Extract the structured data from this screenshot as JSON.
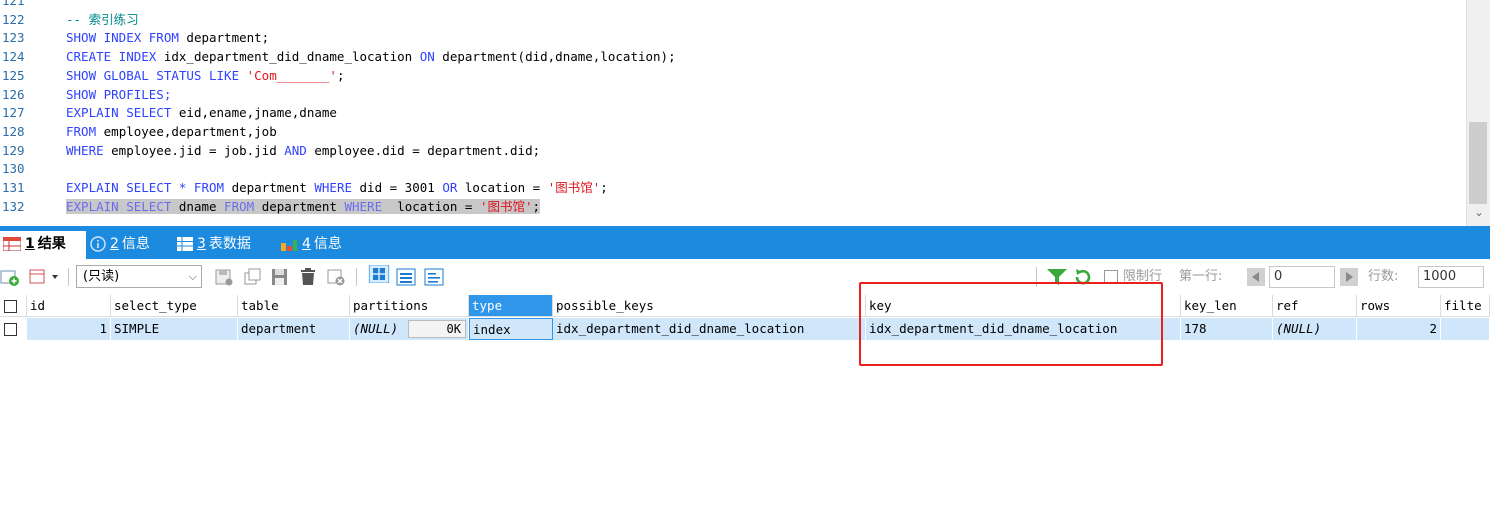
{
  "editor": {
    "lines": [
      {
        "num": "121",
        "tokens": []
      },
      {
        "num": "122",
        "tokens": [
          {
            "t": "-- 索引练习",
            "c": "cm"
          }
        ]
      },
      {
        "num": "123",
        "tokens": [
          {
            "t": "SHOW INDEX FROM ",
            "c": "kw"
          },
          {
            "t": "department;",
            "c": "id"
          }
        ]
      },
      {
        "num": "124",
        "tokens": [
          {
            "t": "CREATE INDEX ",
            "c": "kw"
          },
          {
            "t": "idx_department_did_dname_location ",
            "c": "id"
          },
          {
            "t": "ON ",
            "c": "kw"
          },
          {
            "t": "department(did,dname,location);",
            "c": "id"
          }
        ]
      },
      {
        "num": "125",
        "tokens": [
          {
            "t": "SHOW GLOBAL STATUS LIKE ",
            "c": "kw"
          },
          {
            "t": "'Com_______'",
            "c": "str"
          },
          {
            "t": ";",
            "c": "id"
          }
        ]
      },
      {
        "num": "126",
        "tokens": [
          {
            "t": "SHOW PROFILES;",
            "c": "kw"
          }
        ]
      },
      {
        "num": "127",
        "tokens": [
          {
            "t": "EXPLAIN SELECT ",
            "c": "kw"
          },
          {
            "t": "eid,ename,jname,dname",
            "c": "id"
          }
        ]
      },
      {
        "num": "128",
        "tokens": [
          {
            "t": "FROM ",
            "c": "kw"
          },
          {
            "t": "employee,department,job",
            "c": "id"
          }
        ]
      },
      {
        "num": "129",
        "tokens": [
          {
            "t": "WHERE ",
            "c": "kw"
          },
          {
            "t": "employee.jid = job.jid ",
            "c": "id"
          },
          {
            "t": "AND ",
            "c": "kw"
          },
          {
            "t": "employee.did = department.did;",
            "c": "id"
          }
        ]
      },
      {
        "num": "130",
        "tokens": []
      },
      {
        "num": "131",
        "tokens": [
          {
            "t": "EXPLAIN SELECT * FROM ",
            "c": "kw"
          },
          {
            "t": "department ",
            "c": "id"
          },
          {
            "t": "WHERE ",
            "c": "kw"
          },
          {
            "t": "did = 3001 ",
            "c": "id"
          },
          {
            "t": "OR ",
            "c": "kw"
          },
          {
            "t": "location = ",
            "c": "id"
          },
          {
            "t": "'图书馆'",
            "c": "str"
          },
          {
            "t": ";",
            "c": "id"
          }
        ]
      },
      {
        "num": "132",
        "tokens": [
          {
            "t": "EXPLAIN SELECT ",
            "c": "kwb"
          },
          {
            "t": "dname ",
            "c": "id"
          },
          {
            "t": "FROM ",
            "c": "kwb"
          },
          {
            "t": "department ",
            "c": "id"
          },
          {
            "t": "WHERE ",
            "c": "kwb"
          },
          {
            "t": " location = ",
            "c": "id"
          },
          {
            "t": "'图书馆'",
            "c": "str"
          },
          {
            "t": ";",
            "c": "id"
          }
        ],
        "selected": true
      }
    ]
  },
  "tabs": [
    {
      "num": "1",
      "label": "结果",
      "icon": "grid-result-icon",
      "active": true
    },
    {
      "num": "2",
      "label": "信息",
      "icon": "info-icon"
    },
    {
      "num": "3",
      "label": "表数据",
      "icon": "table-icon"
    },
    {
      "num": "4",
      "label": "信息",
      "icon": "chart-info-icon"
    }
  ],
  "toolbar": {
    "mode_select": "(只读)",
    "limit_label": "限制行",
    "first_row_label": "第一行:",
    "first_row_value": "0",
    "row_count_label": "行数:",
    "row_count_value": "1000"
  },
  "grid": {
    "columns": [
      "id",
      "select_type",
      "table",
      "partitions",
      "type",
      "possible_keys",
      "key",
      "key_len",
      "ref",
      "rows",
      "filte"
    ],
    "rows": [
      {
        "id": "1",
        "select_type": "SIMPLE",
        "table": "department",
        "partitions": "(NULL)",
        "partitions_btn": "0K",
        "type": "index",
        "possible_keys": "idx_department_did_dname_location",
        "key": "idx_department_did_dname_location",
        "key_len": "178",
        "ref": "(NULL)",
        "rows": "2"
      }
    ]
  },
  "colors": {
    "tab_bar": "#1c8ade",
    "row_selected": "#cfe6fb",
    "header_selected": "#2f96ea",
    "highlight_box": "#e8211c"
  }
}
